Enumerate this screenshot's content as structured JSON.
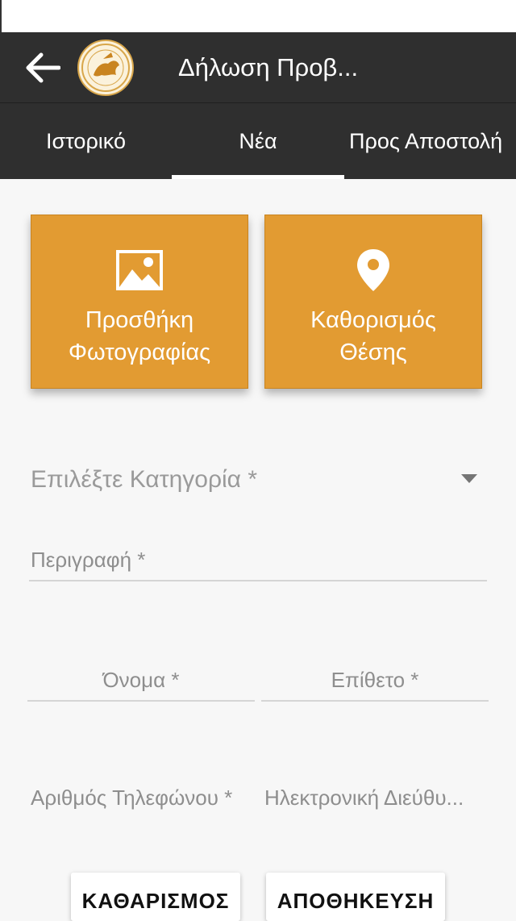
{
  "app_bar": {
    "title": "Δήλωση Προβ...",
    "back_icon": "arrow-left-icon",
    "logo_icon": "municipality-seal-logo"
  },
  "tabs": [
    {
      "label": "Ιστορικό",
      "active": false
    },
    {
      "label": "Νέα",
      "active": true
    },
    {
      "label": "Προς Αποστολή",
      "active": false
    }
  ],
  "actions": {
    "add_photo": {
      "line1": "Προσθήκη",
      "line2": "Φωτογραφίας",
      "icon": "image-icon"
    },
    "set_location": {
      "line1": "Καθορισμός",
      "line2": "Θέσης",
      "icon": "location-pin-icon"
    }
  },
  "form": {
    "category_placeholder": "Επιλέξτε Κατηγορία *",
    "description_placeholder": "Περιγραφή *",
    "first_name_placeholder": "Όνομα *",
    "last_name_placeholder": "Επίθετο *",
    "phone_placeholder": "Αριθμός Τηλεφώνου *",
    "email_placeholder": "Ηλεκτρονική Διεύθυ..."
  },
  "buttons": {
    "clear": "ΚΑΘΑΡΙΣΜΟΣ",
    "save": "ΑΠΟΘΗΚΕΥΣΗ"
  },
  "colors": {
    "app_bar": "#2f2f2f",
    "accent": "#e29b32",
    "background": "#f7f7f7"
  }
}
